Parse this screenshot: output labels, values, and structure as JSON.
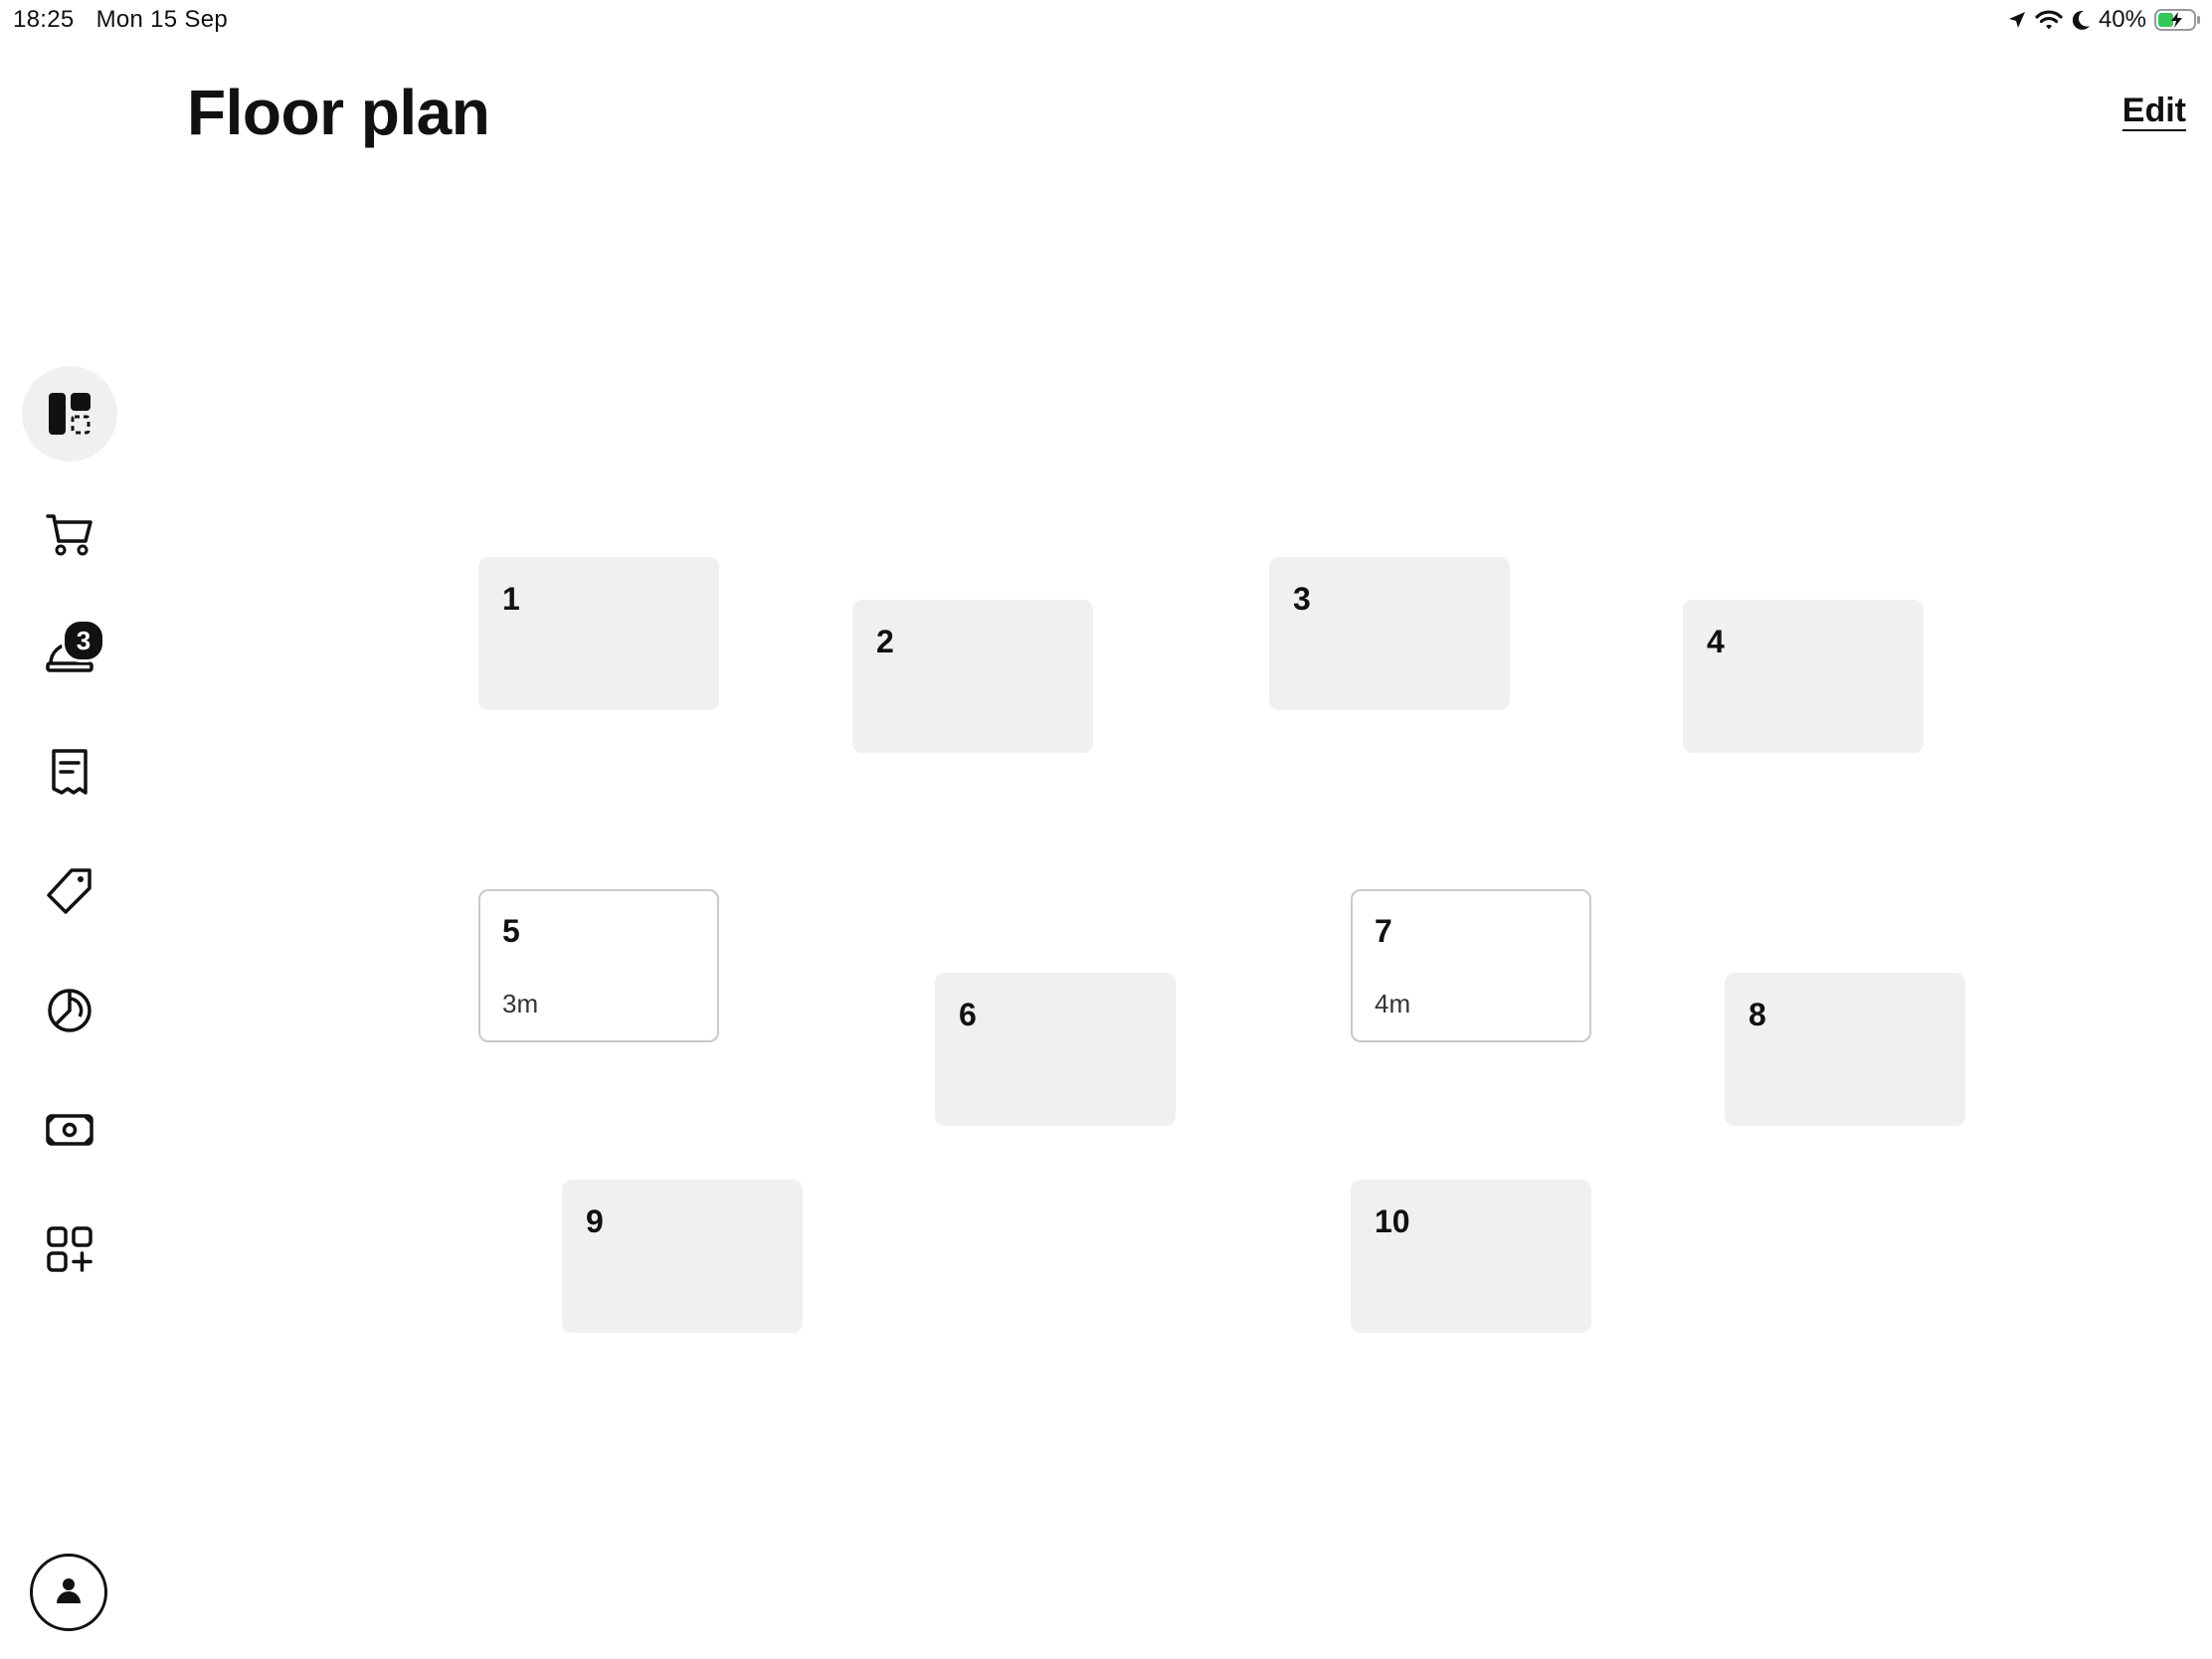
{
  "status_bar": {
    "time": "18:25",
    "date": "Mon 15 Sep",
    "battery": "40%",
    "icons": [
      "location-icon",
      "wifi-icon",
      "moon-icon",
      "battery-charging-icon"
    ]
  },
  "header": {
    "title": "Floor plan",
    "edit_label": "Edit"
  },
  "sidebar": {
    "items": [
      {
        "icon": "floor-plan-icon",
        "active": true
      },
      {
        "icon": "cart-icon"
      },
      {
        "icon": "service-bell-icon",
        "badge": "3"
      },
      {
        "icon": "receipt-icon"
      },
      {
        "icon": "tag-icon"
      },
      {
        "icon": "pie-chart-icon"
      },
      {
        "icon": "cash-icon"
      },
      {
        "icon": "add-apps-icon"
      }
    ],
    "profile_icon": "profile-icon"
  },
  "tables": [
    {
      "number": "1",
      "time": ""
    },
    {
      "number": "2",
      "time": ""
    },
    {
      "number": "3",
      "time": ""
    },
    {
      "number": "4",
      "time": ""
    },
    {
      "number": "5",
      "time": "3m",
      "occupied": true
    },
    {
      "number": "6",
      "time": ""
    },
    {
      "number": "7",
      "time": "4m",
      "occupied": true
    },
    {
      "number": "8",
      "time": ""
    },
    {
      "number": "9",
      "time": ""
    },
    {
      "number": "10",
      "time": ""
    }
  ],
  "colors": {
    "table_free": "#eff0f1",
    "table_occupied_border": "#c9c9c9",
    "text": "#111111",
    "battery_green": "#34c759"
  }
}
